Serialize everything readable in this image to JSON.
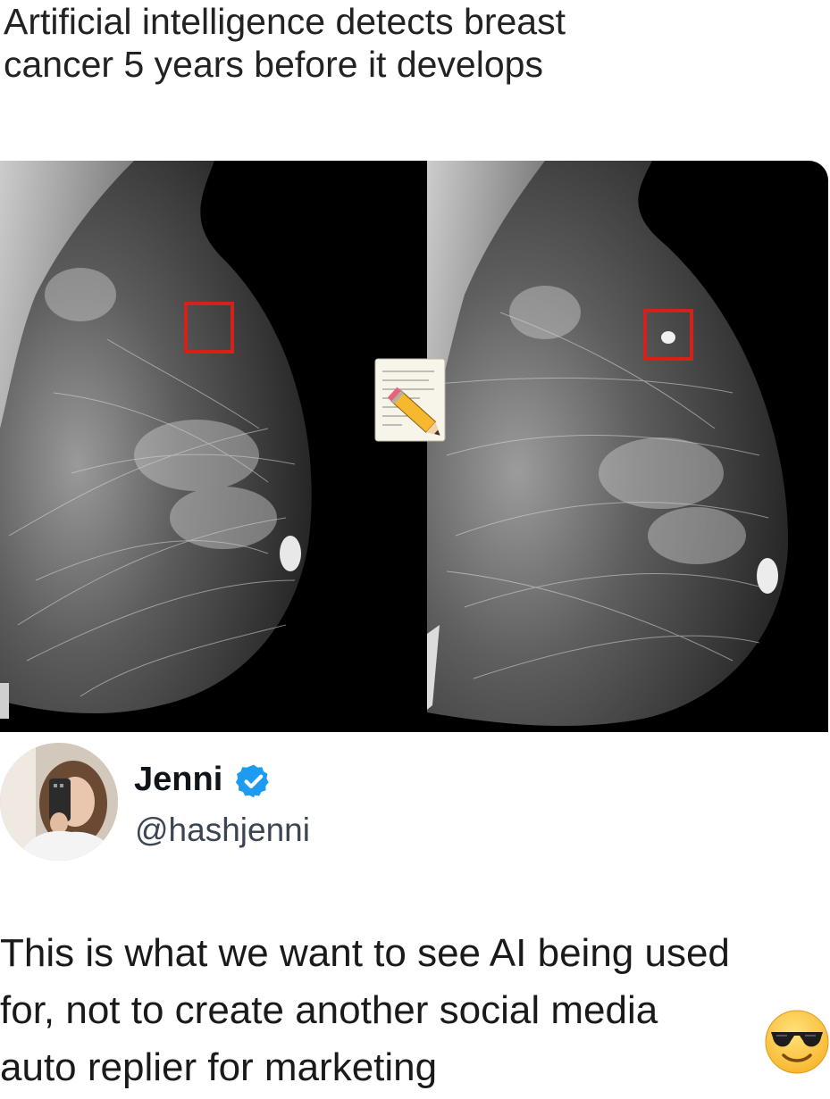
{
  "headline": {
    "line1": "Artificial intelligence detects breast",
    "line2": "cancer 5 years before it develops"
  },
  "image": {
    "left_icon": "mammogram-left",
    "right_icon": "mammogram-right",
    "overlay_icon": "memo-pencil-icon",
    "marker_color": "#d6201c"
  },
  "author": {
    "name": "Jenni",
    "handle": "@hashjenni",
    "verified_icon": "verified-badge-icon",
    "verified_color": "#1d9bf0"
  },
  "tweet": {
    "line1": "This is what we want to see AI being used",
    "line2": "for, not to create another social media",
    "line3": "auto replier for marketing",
    "emoji": "smiling-face-with-sunglasses-icon"
  }
}
